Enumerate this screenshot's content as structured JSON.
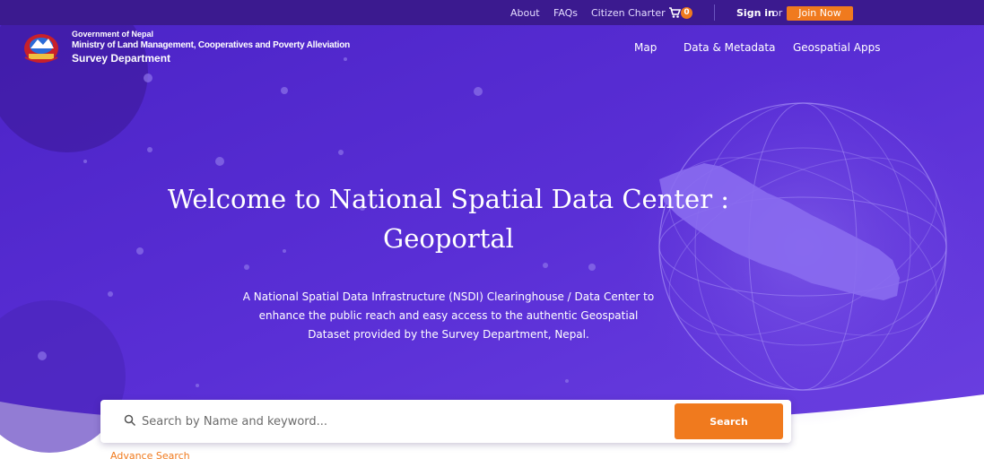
{
  "topbar": {
    "links": [
      "About",
      "FAQs",
      "Citizen Charter"
    ],
    "cart_count": "0",
    "sign_in": "Sign in",
    "or": "or",
    "join": "Join Now"
  },
  "header": {
    "org_line1": "Government of Nepal",
    "org_line2": "Ministry of Land Management, Cooperatives and Poverty Alleviation",
    "org_line3": "Survey Department",
    "nav": [
      "Map",
      "Data & Metadata",
      "Geospatial Apps"
    ]
  },
  "hero": {
    "title_line1": "Welcome to National Spatial Data Center :",
    "title_line2": "Geoportal",
    "subtitle_line1": "A National Spatial Data Infrastructure (NSDI) Clearinghouse / Data Center to",
    "subtitle_line2": "enhance the public reach and easy access to the authentic Geospatial",
    "subtitle_line3": "Dataset provided by the Survey Department, Nepal."
  },
  "search": {
    "placeholder": "Search by Name and keyword...",
    "button": "Search",
    "advance": "Advance Search"
  },
  "colors": {
    "topbar": "#3b1a8f",
    "hero_primary": "#5a2fd6",
    "accent": "#f07a1e"
  },
  "icons": [
    "emblem-logo",
    "cart-icon",
    "search-icon",
    "globe-illustration",
    "nepal-map-illustration"
  ]
}
